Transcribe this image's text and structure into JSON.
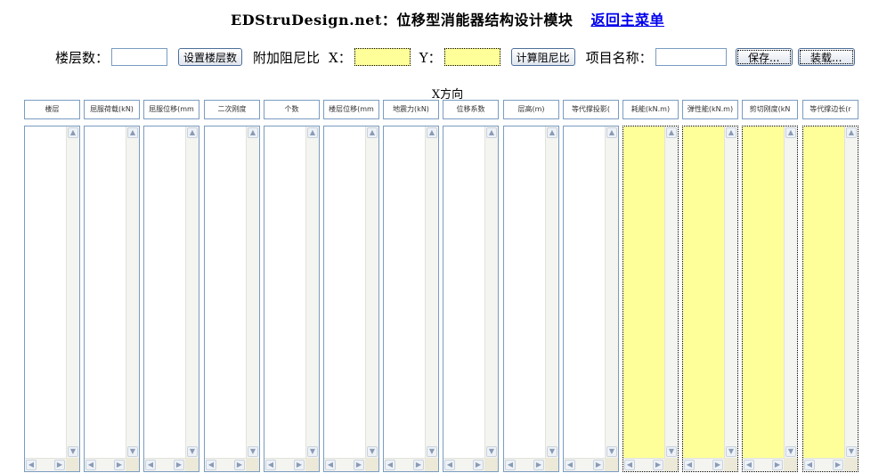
{
  "header": {
    "title": "EDStruDesign.net：位移型消能器结构设计模块",
    "back_link": "返回主菜单"
  },
  "controls": {
    "floors_label": "楼层数：",
    "floors_value": "",
    "set_floors_button": "设置楼层数",
    "damping_label": "附加阻尼比",
    "x_label": "X：",
    "x_value": "",
    "y_label": "Y：",
    "y_value": "",
    "calc_damping_button": "计算阻尼比",
    "project_name_label": "项目名称：",
    "project_name_value": "",
    "save_button": "保存...",
    "load_button": "装载..."
  },
  "direction_label": "X方向",
  "columns": [
    {
      "header": "楼层",
      "highlighted": false
    },
    {
      "header": "屈服荷载(kN)",
      "highlighted": false
    },
    {
      "header": "屈服位移(mm",
      "highlighted": false
    },
    {
      "header": "二次刚度",
      "highlighted": false
    },
    {
      "header": "个数",
      "highlighted": false
    },
    {
      "header": "楼层位移(mm",
      "highlighted": false
    },
    {
      "header": "地震力(kN)",
      "highlighted": false
    },
    {
      "header": "位移系数",
      "highlighted": false
    },
    {
      "header": "层高(m)",
      "highlighted": false
    },
    {
      "header": "等代撑投影(",
      "highlighted": false
    },
    {
      "header": "耗能(kN.m)",
      "highlighted": true
    },
    {
      "header": "弹性能(kN.m)",
      "highlighted": true
    },
    {
      "header": "剪切刚度(kN",
      "highlighted": true
    },
    {
      "header": "等代撑边长(r",
      "highlighted": true
    }
  ],
  "colors": {
    "highlight": "#ffff99",
    "border": "#7a9cc1",
    "link": "#0000ee"
  }
}
